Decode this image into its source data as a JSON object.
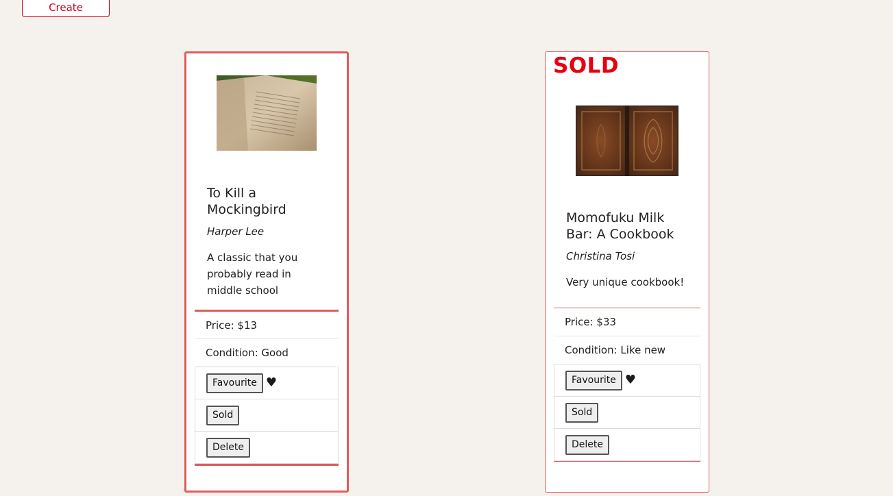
{
  "toolbar": {
    "create_label": "Create"
  },
  "listings": [
    {
      "sold_label": "",
      "title": "To Kill a Mockingbird",
      "author": "Harper Lee",
      "description": "A classic that you probably read in middle school",
      "price": "Price: $13",
      "condition": "Condition: Good",
      "favourite_label": "Favourite",
      "favourite_icon": "♥",
      "sold_button_label": "Sold",
      "delete_label": "Delete"
    },
    {
      "sold_label": "SOLD",
      "title": "Momofuku Milk Bar: A Cookbook",
      "author": "Christina Tosi",
      "description": "Very unique cookbook!",
      "price": "Price: $33",
      "condition": "Condition: Like new",
      "favourite_label": "Favourite",
      "favourite_icon": "♥",
      "sold_button_label": "Sold",
      "delete_label": "Delete"
    }
  ],
  "colors": {
    "accent": "#d0021b",
    "card_border": "#e05b5b",
    "sold_text": "#e8000f",
    "background": "#f5f2ee"
  }
}
